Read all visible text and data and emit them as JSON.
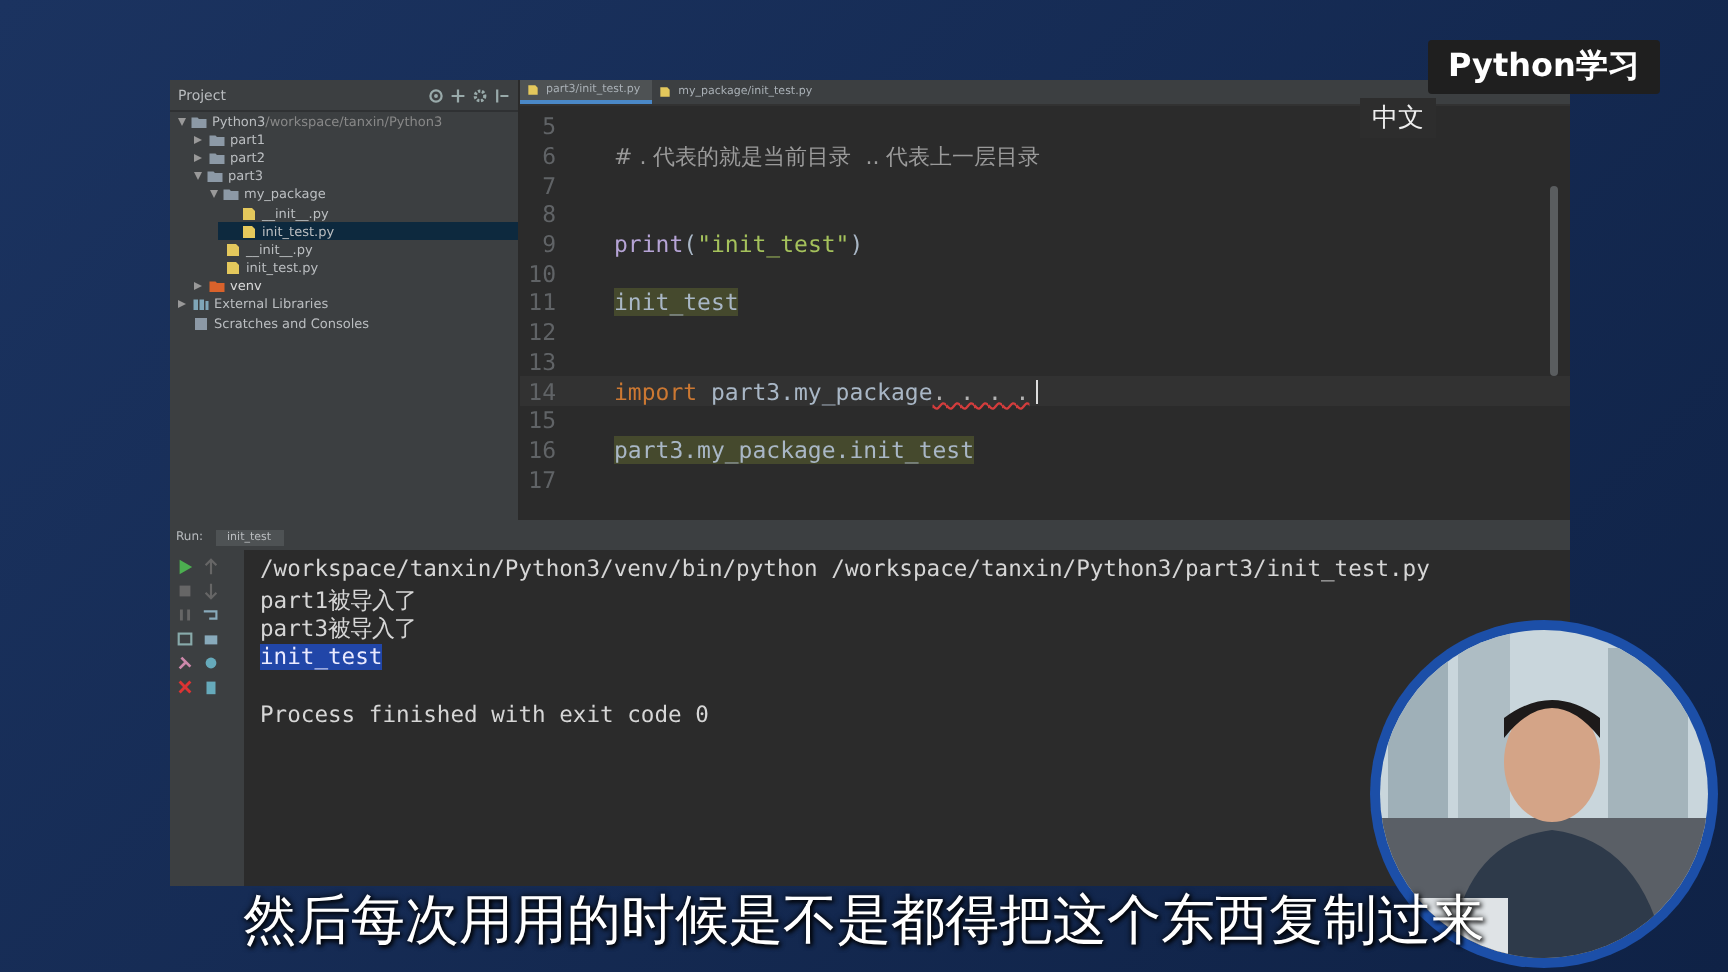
{
  "badge": "Python学习",
  "ime_popup": "中文",
  "project_panel": {
    "title": "Project",
    "tree": [
      {
        "label": "Python3",
        "path": "/workspace/tanxin/Python3",
        "kind": "folder",
        "expanded": true,
        "selected": false,
        "children": [
          {
            "label": "part1",
            "kind": "folder",
            "expanded": false,
            "selected": false
          },
          {
            "label": "part2",
            "kind": "folder",
            "expanded": false,
            "selected": false
          },
          {
            "label": "part3",
            "kind": "folder",
            "expanded": true,
            "selected": false,
            "children": [
              {
                "label": "my_package",
                "kind": "folder",
                "expanded": true,
                "selected": false,
                "children": [
                  {
                    "label": "__init__.py",
                    "kind": "file",
                    "selected": false
                  },
                  {
                    "label": "init_test.py",
                    "kind": "file",
                    "selected": true
                  }
                ]
              },
              {
                "label": "__init__.py",
                "kind": "file",
                "selected": false
              },
              {
                "label": "init_test.py",
                "kind": "file",
                "selected": false
              }
            ]
          },
          {
            "label": "venv",
            "kind": "venv",
            "expanded": false,
            "selected": false
          }
        ]
      },
      {
        "label": "External Libraries",
        "kind": "lib",
        "expanded": false,
        "selected": false
      },
      {
        "label": "Scratches and Consoles",
        "kind": "scratch",
        "selected": false
      }
    ]
  },
  "editor": {
    "tabs": [
      {
        "label": "part3/init_test.py",
        "selected": true
      },
      {
        "label": "my_package/init_test.py",
        "selected": false
      }
    ],
    "lines": [
      {
        "number": "5",
        "current": false
      },
      {
        "number": "6",
        "current": false,
        "tokens": [
          {
            "kind": "comment",
            "text": "# . 代表的就是当前目录  .. 代表上一层目录"
          }
        ]
      },
      {
        "number": "7",
        "current": false
      },
      {
        "number": "8",
        "current": false
      },
      {
        "number": "9",
        "current": false,
        "tokens": [
          {
            "kind": "builtin",
            "text": "print"
          },
          {
            "kind": "plain",
            "text": "("
          },
          {
            "kind": "string",
            "text": "\"init_test\""
          },
          {
            "kind": "plain",
            "text": ")"
          }
        ]
      },
      {
        "number": "10",
        "current": false
      },
      {
        "number": "11",
        "current": false,
        "tokens": [
          {
            "kind": "highlight",
            "text": "init_test"
          }
        ]
      },
      {
        "number": "12",
        "current": false
      },
      {
        "number": "13",
        "current": false
      },
      {
        "number": "14",
        "current": true,
        "tokens": [
          {
            "kind": "keyword",
            "text": "import"
          },
          {
            "kind": "plain",
            "text": " part3.my_package"
          },
          {
            "kind": "error",
            "text": ". . . ."
          }
        ]
      },
      {
        "number": "15",
        "current": false
      },
      {
        "number": "16",
        "current": false,
        "tokens": [
          {
            "kind": "highlight",
            "text": "part3.my_package.init_test"
          }
        ]
      },
      {
        "number": "17",
        "current": false
      }
    ]
  },
  "run_panel": {
    "label": "Run:",
    "tab": "init_test",
    "output": [
      {
        "text": "/workspace/tanxin/Python3/venv/bin/python /workspace/tanxin/Python3/part3/init_test.py",
        "selected": false
      },
      {
        "text": "part1被导入了",
        "selected": false
      },
      {
        "text": "part3被导入了",
        "selected": false
      },
      {
        "text": "init_test",
        "selected": true
      },
      {
        "selected": false
      },
      {
        "text": "Process finished with exit code 0",
        "selected": false
      }
    ]
  },
  "subtitle": "然后每次用用的时候是不是都得把这个东西复制过来"
}
